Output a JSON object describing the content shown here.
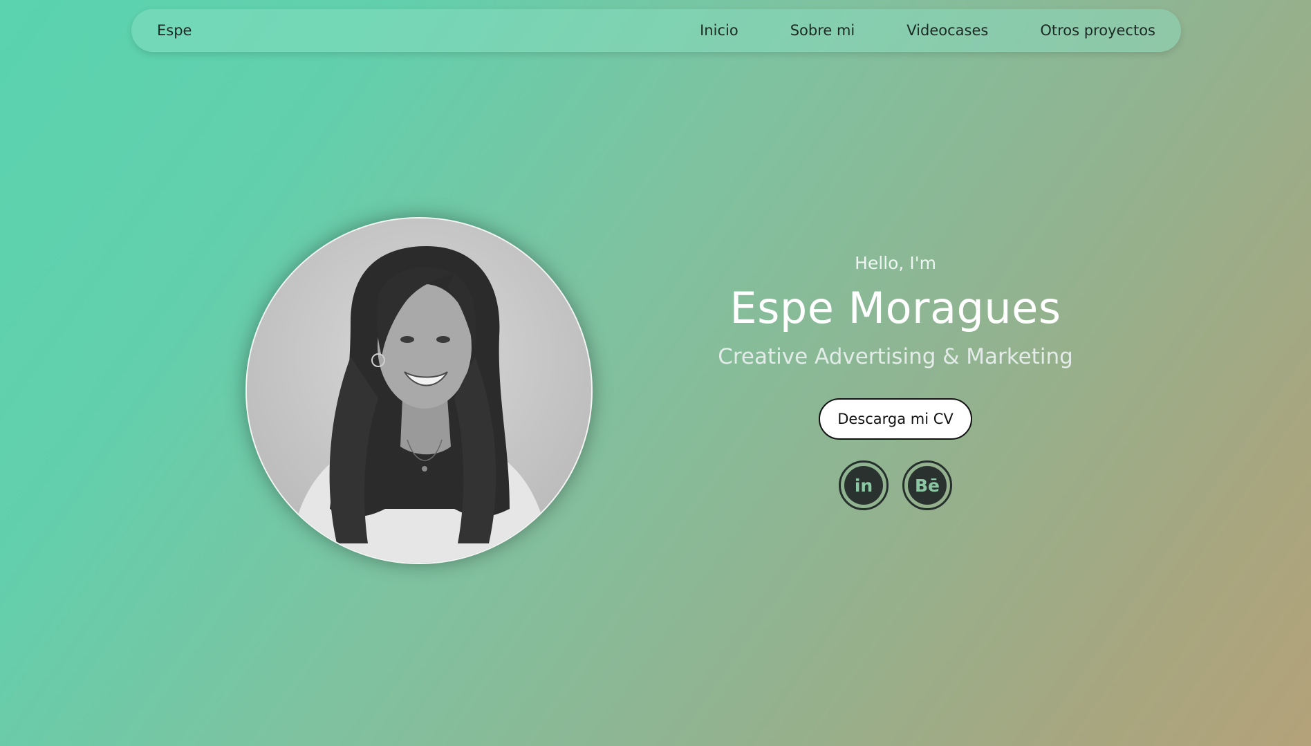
{
  "nav": {
    "brand": "Espe",
    "links": [
      "Inicio",
      "Sobre mi",
      "Videocases",
      "Otros proyectos"
    ]
  },
  "hero": {
    "greeting": "Hello, I'm",
    "name": "Espe Moragues",
    "role": "Creative Advertising & Marketing",
    "cv_button": "Descarga mi CV"
  },
  "socials": [
    {
      "icon": "linkedin-icon",
      "glyph": "in"
    },
    {
      "icon": "behance-icon",
      "glyph": "Bē"
    }
  ],
  "colors": {
    "gradient_start": "#5ad3ae",
    "gradient_end": "#b4a27a",
    "icon_fill": "#2a3230",
    "icon_glyph": "#8cc7a3"
  }
}
